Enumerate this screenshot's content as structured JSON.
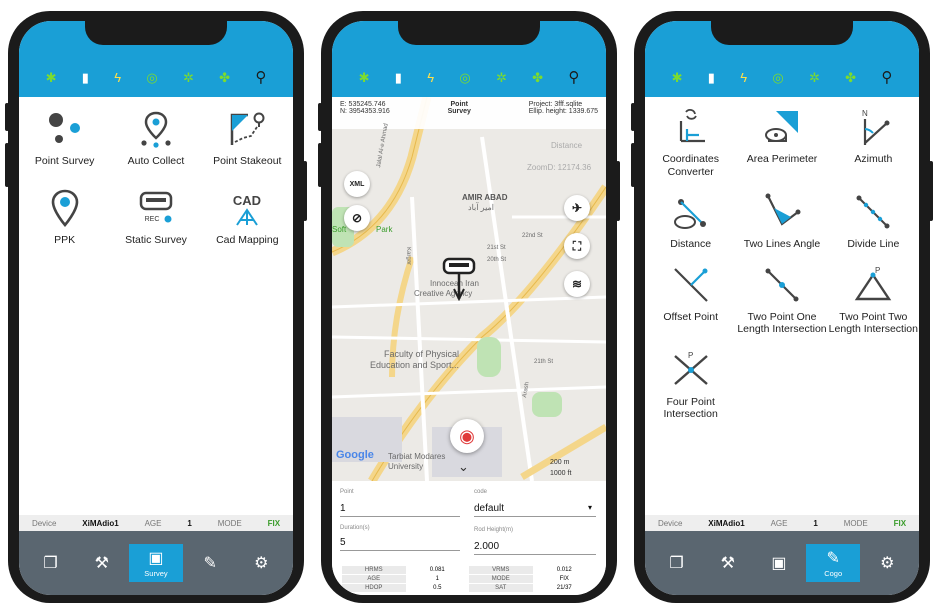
{
  "left_phone": {
    "tiles": [
      {
        "icon": "point-survey-icon",
        "label": "Point Survey"
      },
      {
        "icon": "auto-collect-icon",
        "label": "Auto Collect"
      },
      {
        "icon": "point-stakeout-icon",
        "label": "Point Stakeout"
      },
      {
        "icon": "ppk-icon",
        "label": "PPK"
      },
      {
        "icon": "static-survey-icon",
        "label": "Static Survey",
        "badge": "REC"
      },
      {
        "icon": "cad-mapping-icon",
        "label": "Cad Mapping",
        "badge": "CAD"
      }
    ],
    "info": {
      "device_label": "Device",
      "device_value": "XiMAdio1",
      "age_label": "AGE",
      "age_value": "1",
      "mode_label": "MODE",
      "mode_value": "FIX"
    },
    "nav": {
      "active_label": "Survey"
    }
  },
  "middle_phone": {
    "coords": {
      "e": "E:  535245.746",
      "n": "N:  3954353.916",
      "point_type_line1": "Point",
      "point_type_line2": "Survey",
      "project": "Project:   3fff.sqlite",
      "ellip": "Ellip. height:  1339.675"
    },
    "map_labels": {
      "distance": "Distance",
      "zoom": "ZoomD: 12174.36",
      "area_en": "AMIR ABAD",
      "area_fa": "امیر آباد",
      "st1": "22nd St",
      "st2": "21st St",
      "st3": "20th St",
      "st4": "21th St",
      "place1_line1": "Innocean Iran",
      "place1_line2": "Creative Agency",
      "place2_line1": "Faculty of Physical",
      "place2_line2": "Education and Sport...",
      "place3": "Tarbiat Modares",
      "place3_sub": "University",
      "soft": "Soft",
      "park": "Park",
      "google": "Google",
      "scale_m": "200 m",
      "scale_ft": "1000 ft",
      "highway": "Jalal Al-e Ahmad",
      "vert": "Kargar",
      "east": "Arash"
    },
    "xml_button": "XML",
    "form": {
      "point_label": "Point",
      "point_value": "1",
      "code_label": "code",
      "code_value": "default",
      "duration_label": "Duration(s)",
      "duration_value": "5",
      "rod_label": "Rod Height(m)",
      "rod_value": "2.000"
    },
    "stats": [
      [
        "HRMS",
        "0.081",
        "VRMS",
        "0.012"
      ],
      [
        "AGE",
        "1",
        "MODE",
        "FIX"
      ],
      [
        "HDOP",
        "0.5",
        "SAT",
        "21/37"
      ]
    ]
  },
  "right_phone": {
    "tiles": [
      {
        "icon": "coordinates-converter-icon",
        "label": "Coordinates Converter"
      },
      {
        "icon": "area-perimeter-icon",
        "label": "Area Perimeter"
      },
      {
        "icon": "azimuth-icon",
        "label": "Azimuth"
      },
      {
        "icon": "distance-icon",
        "label": "Distance"
      },
      {
        "icon": "two-lines-angle-icon",
        "label": "Two Lines Angle"
      },
      {
        "icon": "divide-line-icon",
        "label": "Divide Line"
      },
      {
        "icon": "offset-point-icon",
        "label": "Offset Point"
      },
      {
        "icon": "two-point-one-length-icon",
        "label": "Two Point One Length Intersection"
      },
      {
        "icon": "two-point-two-length-icon",
        "label": "Two Point Two Length Intersection"
      },
      {
        "icon": "four-point-intersection-icon",
        "label": "Four Point Intersection"
      }
    ],
    "info": {
      "device_label": "Device",
      "device_value": "XiMAdio1",
      "age_label": "AGE",
      "age_value": "1",
      "mode_label": "MODE",
      "mode_value": "FIX"
    },
    "nav": {
      "active_label": "Cogo"
    }
  },
  "colors": {
    "accent": "#1a9fd6",
    "nav": "#5a6670",
    "fix": "#3a9c2b",
    "status_icon": "#7cdc2e"
  }
}
